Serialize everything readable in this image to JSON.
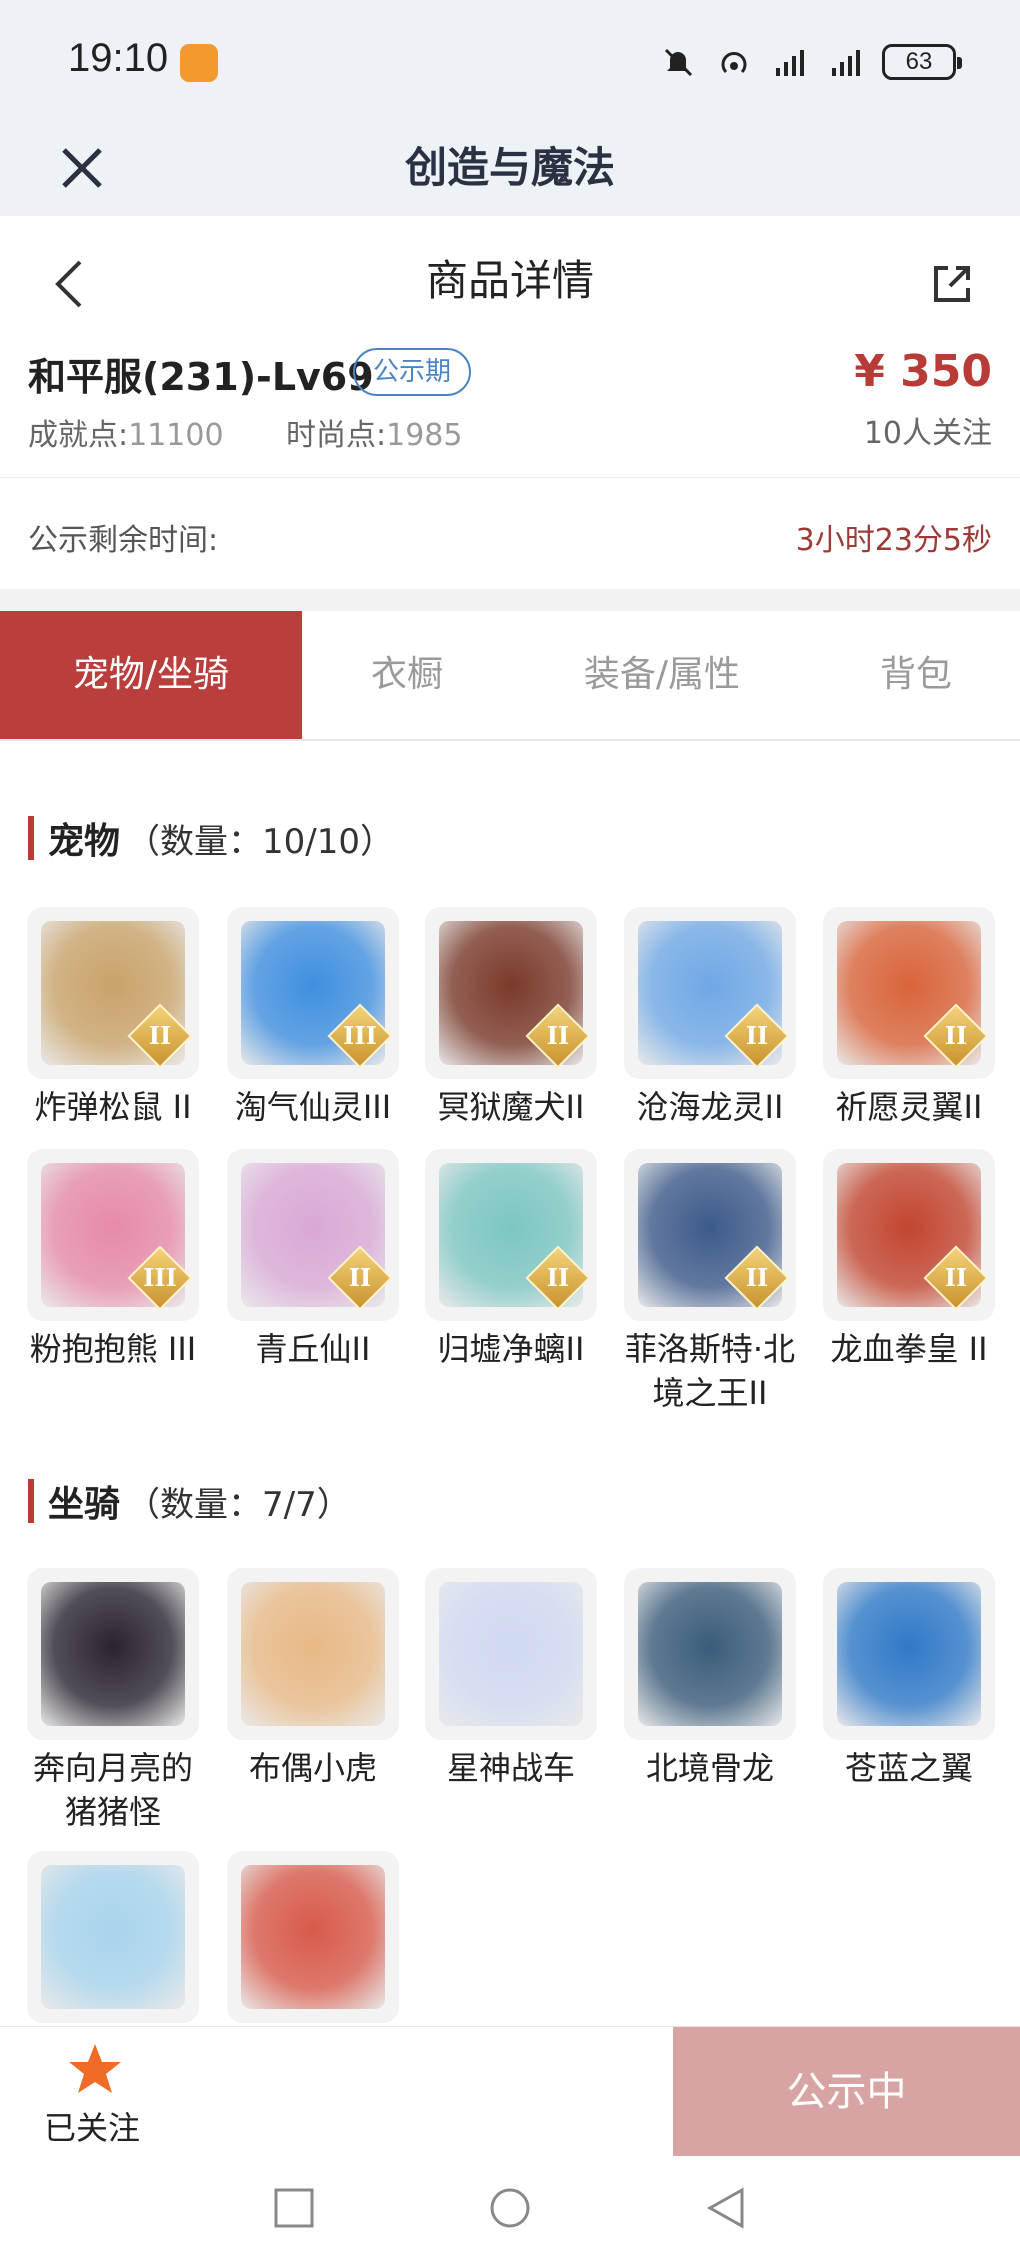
{
  "status_bar": {
    "time": "19:10",
    "battery": "63"
  },
  "app_bar": {
    "title": "创造与魔法"
  },
  "nav": {
    "title": "商品详情"
  },
  "product": {
    "name": "和平服(231)-Lv69",
    "tag": "公示期",
    "achievement_label": "成就点:",
    "achievement_value": "11100",
    "fashion_label": "时尚点:",
    "fashion_value": "1985",
    "price": "¥ 350",
    "followers": "10人关注"
  },
  "remaining": {
    "label": "公示剩余时间:",
    "value": "3小时23分5秒"
  },
  "tabs": [
    {
      "label": "宠物/坐骑",
      "active": true
    },
    {
      "label": "衣橱"
    },
    {
      "label": "装备/属性"
    },
    {
      "label": "背包"
    }
  ],
  "pets": {
    "title": "宠物",
    "count": "（数量：10/10）",
    "items": [
      {
        "name": "炸弹松鼠 II",
        "rank": "II",
        "color": "#c9a36a"
      },
      {
        "name": "淘气仙灵III",
        "rank": "III",
        "color": "#3f8fe0"
      },
      {
        "name": "冥狱魔犬II",
        "rank": "II",
        "color": "#7a3a2a"
      },
      {
        "name": "沧海龙灵II",
        "rank": "II",
        "color": "#6fa8e6"
      },
      {
        "name": "祈愿灵翼II",
        "rank": "II",
        "color": "#d9643a"
      },
      {
        "name": "粉抱抱熊 III",
        "rank": "III",
        "color": "#e68aa8"
      },
      {
        "name": "青丘仙II",
        "rank": "II",
        "color": "#d9a8d6"
      },
      {
        "name": "归墟净螭II",
        "rank": "II",
        "color": "#7cc6c2"
      },
      {
        "name": "菲洛斯特·北境之王II",
        "rank": "II",
        "color": "#3c5a8a"
      },
      {
        "name": "龙血拳皇 II",
        "rank": "II",
        "color": "#c2452f"
      }
    ]
  },
  "mounts": {
    "title": "坐骑",
    "count": "（数量：7/7）",
    "items": [
      {
        "name": "奔向月亮的猪猪怪",
        "color": "#2b2430"
      },
      {
        "name": "布偶小虎",
        "color": "#e8b986"
      },
      {
        "name": "星神战车",
        "color": "#cfd9f2"
      },
      {
        "name": "北境骨龙",
        "color": "#3a5c7a"
      },
      {
        "name": "苍蓝之翼",
        "color": "#2f79c8"
      },
      {
        "name": "",
        "color": "#a8d4ec"
      },
      {
        "name": "",
        "color": "#d85a4a"
      }
    ]
  },
  "bottom": {
    "follow_label": "已关注",
    "action_label": "公示中"
  }
}
